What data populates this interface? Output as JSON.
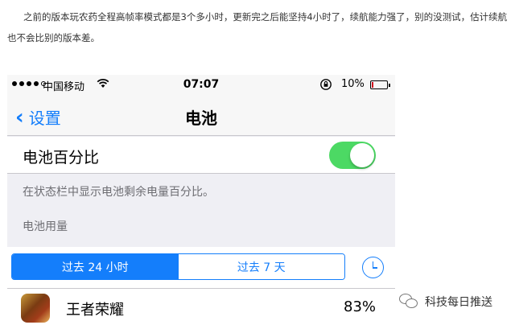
{
  "article": {
    "text": "之前的版本玩农药全程高帧率模式都是3个多小时，更新完之后能坚持4小时了，续航能力强了，别的没测试，估计续航也不会比别的版本差。"
  },
  "status_bar": {
    "carrier": "中国移动",
    "time": "07:07",
    "battery_percent": "10%",
    "icons": [
      "signal-dots",
      "wifi-icon",
      "rotation-lock-icon",
      "battery-icon"
    ],
    "battery_level": 0.1
  },
  "nav": {
    "back_label": "设置",
    "back_icon": "chevron-left-icon",
    "title": "电池"
  },
  "battery_percentage": {
    "label": "电池百分比",
    "enabled": true,
    "footer": "在状态栏中显示电池剩余电量百分比。"
  },
  "usage": {
    "section_header": "电池用量",
    "segments": [
      "过去 24 小时",
      "过去 7 天"
    ],
    "selected_segment": 0,
    "clock_icon": "clock-icon"
  },
  "apps": [
    {
      "name": "王者荣耀",
      "percent": "83%"
    }
  ],
  "watermark": {
    "text": "科技每日推送",
    "icon": "wechat-icon"
  },
  "colors": {
    "ios_blue": "#147efb",
    "switch_on": "#4cd964",
    "battery_low": "#d0021b"
  }
}
